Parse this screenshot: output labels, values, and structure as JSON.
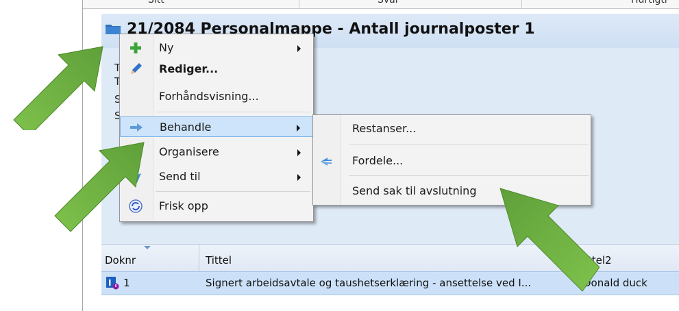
{
  "top_tabs": [
    "Sitt",
    "Svar",
    "Hurtigtr"
  ],
  "folder": {
    "title": "21/2084 Personalmappe - Antall journalposter 1",
    "icon": "folder-icon"
  },
  "details_letters": [
    "T",
    "T",
    "S",
    "S"
  ],
  "context_menu": {
    "items": [
      {
        "label": "Ny",
        "icon": "plus-icon",
        "submenu": true
      },
      {
        "label": "Rediger...",
        "icon": "pencil-icon",
        "bold": true
      },
      {
        "label": "Forhåndsvisning...",
        "icon": ""
      },
      {
        "label": "Behandle",
        "icon": "process-arrows-icon",
        "submenu": true,
        "highlighted": true
      },
      {
        "label": "Organisere",
        "icon": "",
        "submenu": true
      },
      {
        "label": "Send til",
        "icon": "send-icon",
        "submenu": true
      },
      {
        "label": "Frisk opp",
        "icon": "refresh-icon"
      }
    ]
  },
  "submenu": {
    "items": [
      {
        "label": "Restanser..."
      },
      {
        "label": "Fordele...",
        "icon": "distribute-icon"
      },
      {
        "label": "Send sak til avslutning"
      }
    ]
  },
  "grid": {
    "columns": [
      "Doknr",
      "Tittel",
      "Tittel2"
    ],
    "rows": [
      {
        "doknr": "1",
        "tittel": "Signert arbeidsavtale og taushetserklæring - ansettelse ved I...",
        "tittel2": "Donald duck",
        "icon": "document-status-icon"
      }
    ]
  },
  "colors": {
    "highlight": "#cde4fb",
    "header_blue": "#dde9f7",
    "arrow_green": "#6fb043"
  }
}
